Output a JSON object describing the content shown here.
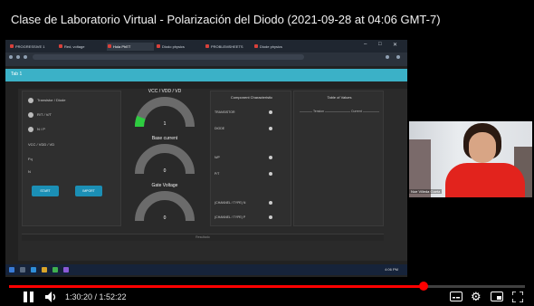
{
  "video": {
    "title": "Clase de Laboratorio Virtual - Polarización del Diodo (2021-09-28 at 04:06 GMT-7)",
    "current_time": "1:30:20",
    "duration": "1:52:22",
    "time_display": "1:30:20 / 1:52:22",
    "progress": 0.803,
    "accent_color": "#ff0000"
  },
  "browser": {
    "tabs": [
      "PROGRESSIVE 1",
      "Red, voltage",
      "Hola PhET",
      "Diodo physics",
      "PROBLEMSHEETS",
      "Diode physics"
    ],
    "active_tab_index": 2
  },
  "app": {
    "header_tab": "Tab 1",
    "header_color": "#3bb1c7",
    "left_panel": {
      "radios": [
        "Transistor / Diode",
        "R/T / V/T",
        "N / P"
      ],
      "field_label": "VCC / VDD / VD",
      "label_fq": "Fq",
      "label_n": "N",
      "buttons": [
        "START",
        "IMPORT"
      ]
    },
    "gauges": [
      {
        "title": "VCC / VDD / VD",
        "value": "1",
        "level": 0.12,
        "fill_color": "#2ecc40"
      },
      {
        "title": "Base current",
        "value": "0",
        "level": 0.0,
        "fill_color": "#2ecc40"
      },
      {
        "title": "Gate Voltage",
        "value": "0",
        "level": 0.0,
        "fill_color": "#2ecc40"
      }
    ],
    "component_panel": {
      "title": "Component Characteristic",
      "rows": [
        "TRANSISTOR",
        "DIODE",
        "N/P",
        "P/T",
        "(CHANNEL / TYPE) N",
        "(CHANNEL / TYPE) P"
      ]
    },
    "table_panel": {
      "title": "Table of Values",
      "columns": [
        "Tension",
        "Current"
      ]
    },
    "bottom_label": "Resultado"
  },
  "taskbar": {
    "clock": "4:06 PM"
  },
  "webcam": {
    "label": "Noe Villeda Gaeta"
  }
}
